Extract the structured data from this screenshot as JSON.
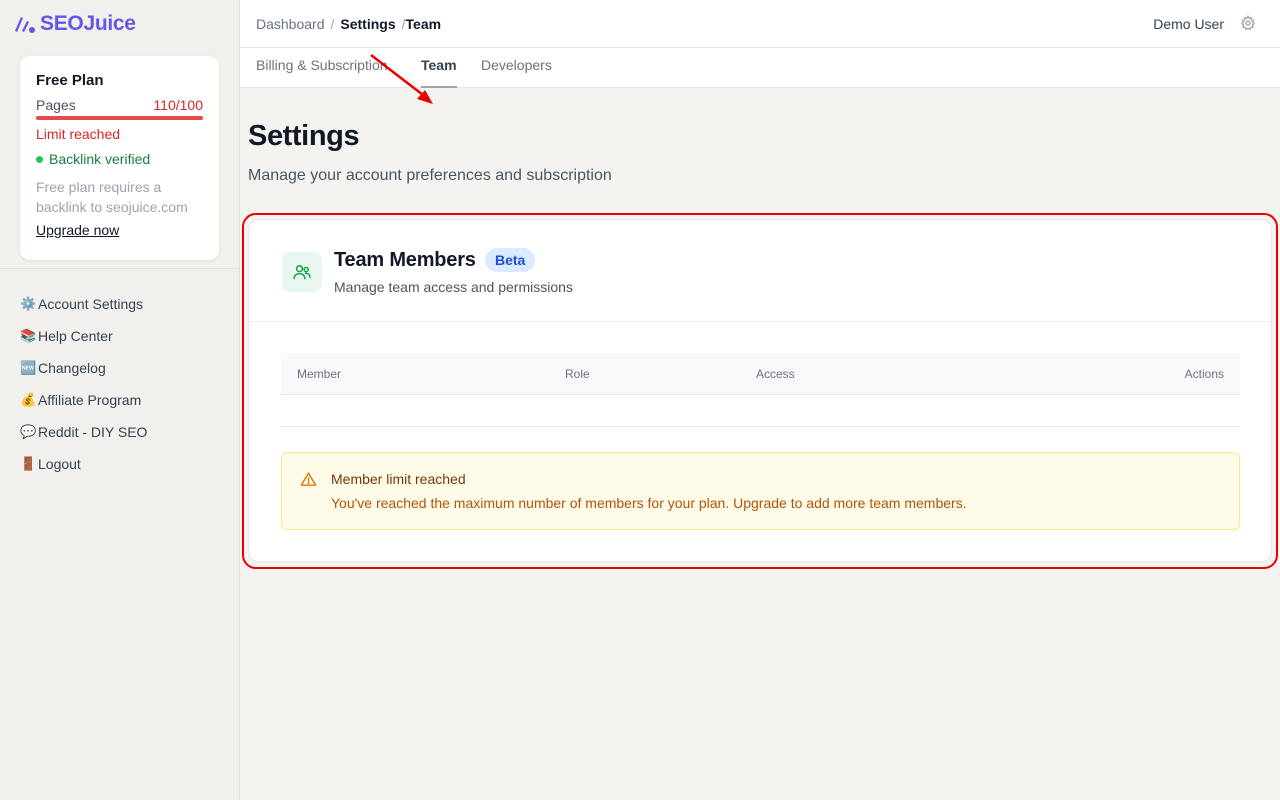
{
  "app": {
    "name": "SEOJuice",
    "brand_color": "#6358e6"
  },
  "plan": {
    "title": "Free Plan",
    "pages_label": "Pages",
    "pages_count": "110/100",
    "usage_fraction": 1.0,
    "limit_text": "Limit reached",
    "backlink_status": "Backlink verified",
    "note": "Free plan requires a backlink to seojuice.com",
    "upgrade_label": "Upgrade now"
  },
  "sidebar": {
    "items": [
      {
        "icon": "⚙️",
        "label": "Account Settings"
      },
      {
        "icon": "📚",
        "label": "Help Center"
      },
      {
        "icon": "🆕",
        "label": "Changelog"
      },
      {
        "icon": "💰",
        "label": "Affiliate Program"
      },
      {
        "icon": "💬",
        "label": "Reddit - DIY SEO"
      },
      {
        "icon": "🚪",
        "label": "Logout"
      }
    ]
  },
  "topbar": {
    "breadcrumb": [
      "Dashboard",
      "Settings",
      "Team"
    ],
    "separator": "/",
    "user_name": "Demo User"
  },
  "tabs": [
    {
      "label": "Billing & Subscription",
      "active": false
    },
    {
      "label": "Team",
      "active": true
    },
    {
      "label": "Developers",
      "active": false
    }
  ],
  "page": {
    "title": "Settings",
    "subtitle": "Manage your account preferences and subscription"
  },
  "team_card": {
    "title": "Team Members",
    "badge": "Beta",
    "subtitle": "Manage team access and permissions",
    "columns": [
      "Member",
      "Role",
      "Access",
      "Actions"
    ],
    "rows": [],
    "alert": {
      "title": "Member limit reached",
      "text": "You've reached the maximum number of members for your plan. Upgrade to add more team members."
    }
  }
}
